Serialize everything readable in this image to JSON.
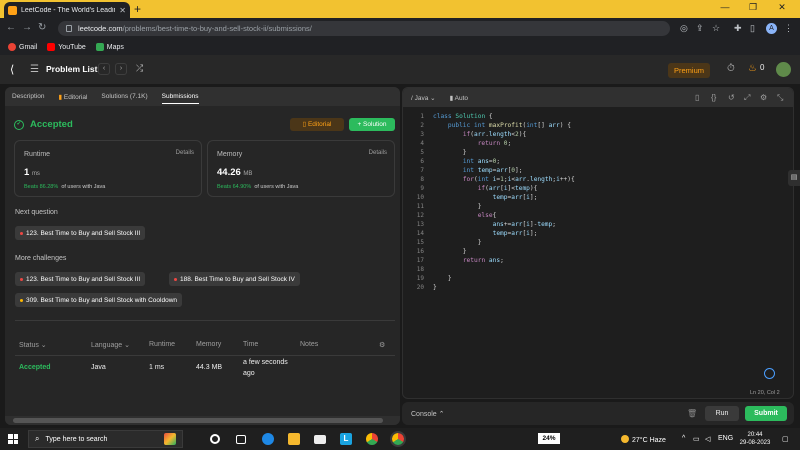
{
  "browser": {
    "tab_title": "LeetCode - The World's Leading",
    "new_tab": "+",
    "url_host": "leetcode.com",
    "url_path": "/problems/best-time-to-buy-and-sell-stock-ii/submissions/",
    "min": "—",
    "max": "❐",
    "close": "✕",
    "profile_initial": "A"
  },
  "bookmarks": [
    {
      "label": "Gmail",
      "color": "#ea4335"
    },
    {
      "label": "YouTube",
      "color": "#ff0000"
    },
    {
      "label": "Maps",
      "color": "#34a853"
    }
  ],
  "lc_nav": {
    "problem_list": "Problem List",
    "premium": "Premium",
    "notif_count": "0"
  },
  "left": {
    "tabs": {
      "description": "Description",
      "editorial": "Editorial",
      "solutions": "Solutions (7.1K)",
      "submissions": "Submissions"
    },
    "status": "Accepted",
    "editorial_btn": "Editorial",
    "solution_btn": "Solution",
    "runtime": {
      "label": "Runtime",
      "details": "Details",
      "value": "1",
      "unit": "ms",
      "beats_pct": "Beats 86.28%",
      "beats_suffix": "of users with Java"
    },
    "memory": {
      "label": "Memory",
      "details": "Details",
      "value": "44.26",
      "unit": "MB",
      "beats_pct": "Beats 64.90%",
      "beats_suffix": "of users with Java"
    },
    "next_question_label": "Next question",
    "next_question": "123. Best Time to Buy and Sell Stock III",
    "more_challenges_label": "More challenges",
    "challenges": [
      {
        "label": "123. Best Time to Buy and Sell Stock III",
        "color": "#ef4743"
      },
      {
        "label": "188. Best Time to Buy and Sell Stock IV",
        "color": "#ef4743"
      },
      {
        "label": "309. Best Time to Buy and Sell Stock with Cooldown",
        "color": "#ffb800"
      }
    ],
    "table": {
      "headers": {
        "status": "Status",
        "language": "Language",
        "runtime": "Runtime",
        "memory": "Memory",
        "time": "Time",
        "notes": "Notes"
      },
      "row": {
        "status": "Accepted",
        "language": "Java",
        "runtime": "1 ms",
        "memory": "44.3 MB",
        "time_line1": "a few seconds",
        "time_line2": "ago"
      }
    }
  },
  "editor": {
    "language": "Java",
    "mode": "Auto",
    "cursor": "Ln 20, Col 2",
    "line_numbers": [
      "1",
      "2",
      "3",
      "4",
      "5",
      "6",
      "7",
      "8",
      "9",
      "10",
      "11",
      "12",
      "13",
      "14",
      "15",
      "16",
      "17",
      "18",
      "19",
      "20"
    ]
  },
  "console": {
    "label": "Console",
    "run": "Run",
    "submit": "Submit"
  },
  "taskbar": {
    "search_placeholder": "Type here to search",
    "battery": "24%",
    "weather": "27°C  Haze",
    "lang": "ENG",
    "time": "20:44",
    "date": "29-08-2023"
  },
  "colors": {
    "accent_green": "#2cbb5d",
    "premium_orange": "#ffa116",
    "chrome_yellow": "#f2c230"
  }
}
